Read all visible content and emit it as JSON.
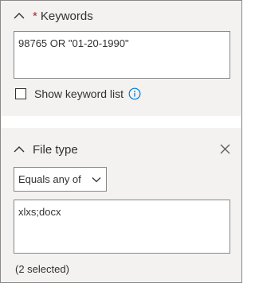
{
  "keywords": {
    "title": "Keywords",
    "required_marker": "*",
    "value": "98765 OR \"01-20-1990\"",
    "show_list_label": "Show keyword list",
    "show_list_checked": false
  },
  "file_type": {
    "title": "File type",
    "operator": "Equals any of",
    "value": "xlxs;docx",
    "selection_status": "(2 selected)"
  },
  "colors": {
    "accent": "#0078d4",
    "required": "#a4262c",
    "panel_bg": "#f3f2f1",
    "border": "#8a8886"
  },
  "icons": [
    "chevron-up-icon",
    "info-icon",
    "close-icon",
    "chevron-down-icon"
  ]
}
